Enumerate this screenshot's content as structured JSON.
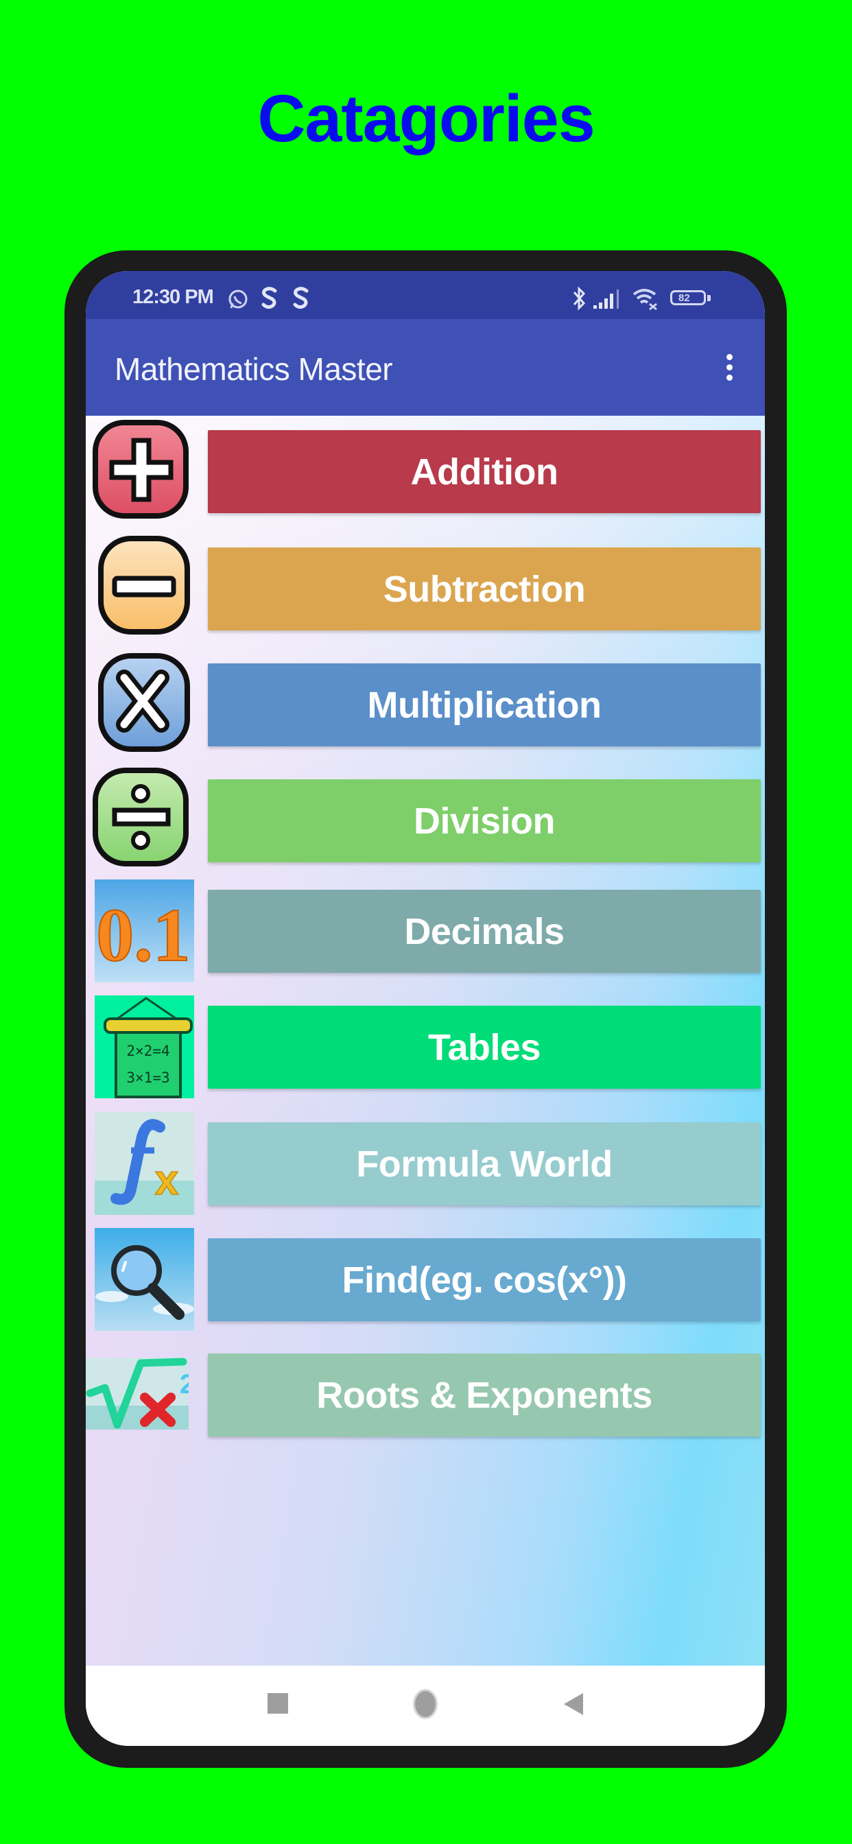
{
  "page": {
    "heading": "Catagories",
    "background_color": "#00ff00",
    "heading_color": "#0a0cf0"
  },
  "status_bar": {
    "time": "12:30 PM",
    "left_icons": [
      "whatsapp-icon",
      "s-app-icon",
      "s-app-icon"
    ],
    "right_icons": [
      "bluetooth-icon",
      "signal-icon",
      "wifi-icon",
      "battery-icon"
    ],
    "battery_level": "82",
    "color": "#303f9f"
  },
  "app_bar": {
    "title": "Mathematics Master",
    "menu_icon": "overflow-menu-icon",
    "color": "#3f51b5"
  },
  "categories": [
    {
      "label": "Addition",
      "icon": "plus-icon",
      "color": "#b83a4b"
    },
    {
      "label": "Subtraction",
      "icon": "minus-icon",
      "color": "#dba54f"
    },
    {
      "label": "Multiplication",
      "icon": "multiply-icon",
      "color": "#5b8fc9"
    },
    {
      "label": "Division",
      "icon": "divide-icon",
      "color": "#7ece6a"
    },
    {
      "label": "Decimals",
      "icon": "decimal-icon",
      "icon_text": "0.1",
      "color": "#7eaaaa"
    },
    {
      "label": "Tables",
      "icon": "tables-board-icon",
      "icon_lines": [
        "2×2=4",
        "3×1=3"
      ],
      "color": "#00dc78"
    },
    {
      "label": "Formula World",
      "icon": "function-fx-icon",
      "icon_text": "fx",
      "color": "#96ccce"
    },
    {
      "label": "Find(eg. cos(x°))",
      "icon": "magnifier-icon",
      "color": "#68a9d0"
    },
    {
      "label": "Roots & Exponents",
      "icon": "square-root-icon",
      "icon_text": "2",
      "color": "#96c8b0"
    }
  ],
  "nav_bar": {
    "buttons": [
      "recents-icon",
      "home-icon",
      "back-icon"
    ]
  }
}
